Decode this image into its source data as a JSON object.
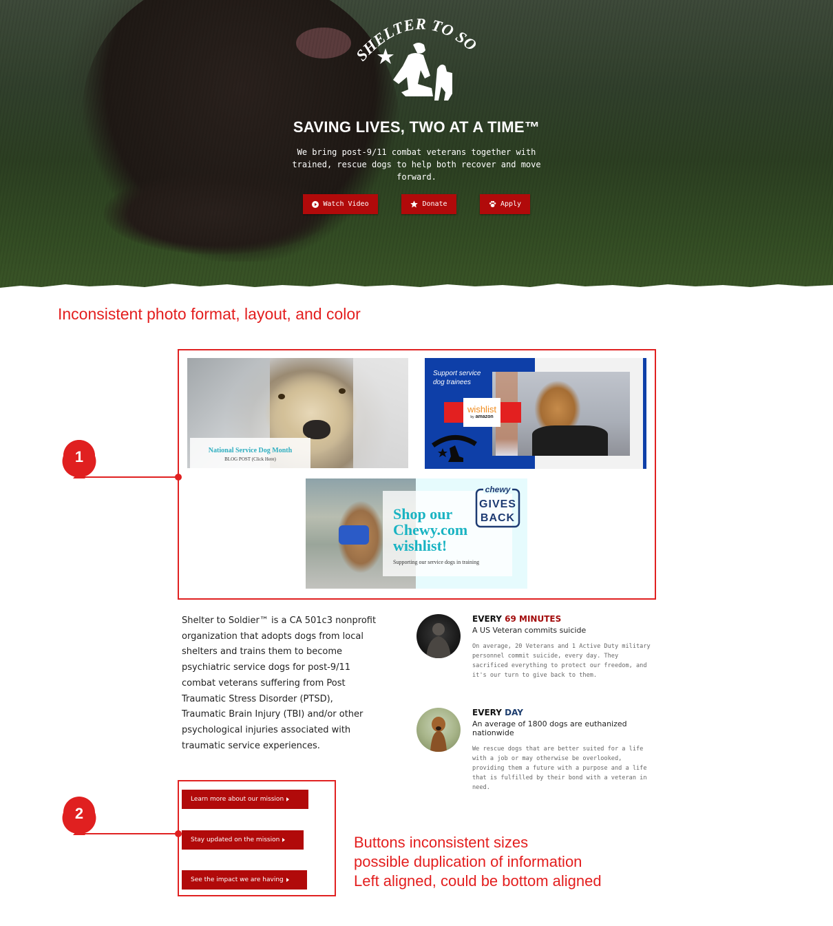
{
  "hero": {
    "logo_text": "SHELTER TO SOLDIER",
    "title": "SAVING LIVES, TWO AT A TIME™",
    "subtitle": "We bring post-9/11 combat veterans together with trained, rescue dogs to help both recover and move forward.",
    "buttons": [
      {
        "label": "Watch Video",
        "icon": "play-circle-icon"
      },
      {
        "label": "Donate",
        "icon": "star-icon"
      },
      {
        "label": "Apply",
        "icon": "paw-icon"
      }
    ]
  },
  "annotations": {
    "heading": "Inconsistent photo format, layout, and color",
    "marker_1": "1",
    "marker_2": "2",
    "note_lines": [
      "Buttons inconsistent sizes",
      "possible duplication of information",
      "Left aligned, could be bottom aligned"
    ],
    "color": "#e02020"
  },
  "promos": {
    "card1": {
      "title": "National Service Dog Month",
      "subtitle": "BLOG POST (Click Here)"
    },
    "card2": {
      "text_line1": "Support service",
      "text_line2": "dog trainees",
      "wishlist": "wishlist",
      "by": "by",
      "amazon": "amazon"
    },
    "card3": {
      "line1": "Shop our",
      "line2": "Chewy.com",
      "line3": "wishlist!",
      "support": "Supporting our service dogs in training",
      "chewy": "chewy",
      "gives": "GIVES",
      "back": "BACK"
    }
  },
  "about": {
    "text": "Shelter to Soldier™ is a CA 501c3 nonprofit organization that adopts dogs from local shelters and trains them to become psychiatric service dogs for post-9/11 combat veterans suffering from Post Traumatic Stress Disorder (PTSD), Traumatic Brain Injury (TBI) and/or other psychological injuries associated with traumatic service experiences."
  },
  "cta_buttons": [
    {
      "label": "Learn more about our mission"
    },
    {
      "label": "Stay updated on the mission"
    },
    {
      "label": "See the impact we are having"
    }
  ],
  "stats": [
    {
      "head_prefix": "EVERY ",
      "head_highlight": "69 MINUTES",
      "subhead": "A US Veteran commits suicide",
      "body": "On average, 20 Veterans and 1 Active Duty military personnel commit suicide, every day. They sacrificed everything to protect our freedom, and it's our turn to give back to them."
    },
    {
      "head_prefix": "EVERY ",
      "head_highlight": "DAY",
      "subhead": "An average of 1800 dogs are euthanized nationwide",
      "body": "We rescue dogs that are better suited for a life with a job or may otherwise be overlooked, providing them a future with a purpose and a life that is fulfilled by their bond with a veteran in need."
    }
  ],
  "colors": {
    "brand_red": "#b10a0a",
    "annotation_red": "#e02020",
    "stat_red": "#a30c0c",
    "stat_navy": "#1c3d6e"
  }
}
